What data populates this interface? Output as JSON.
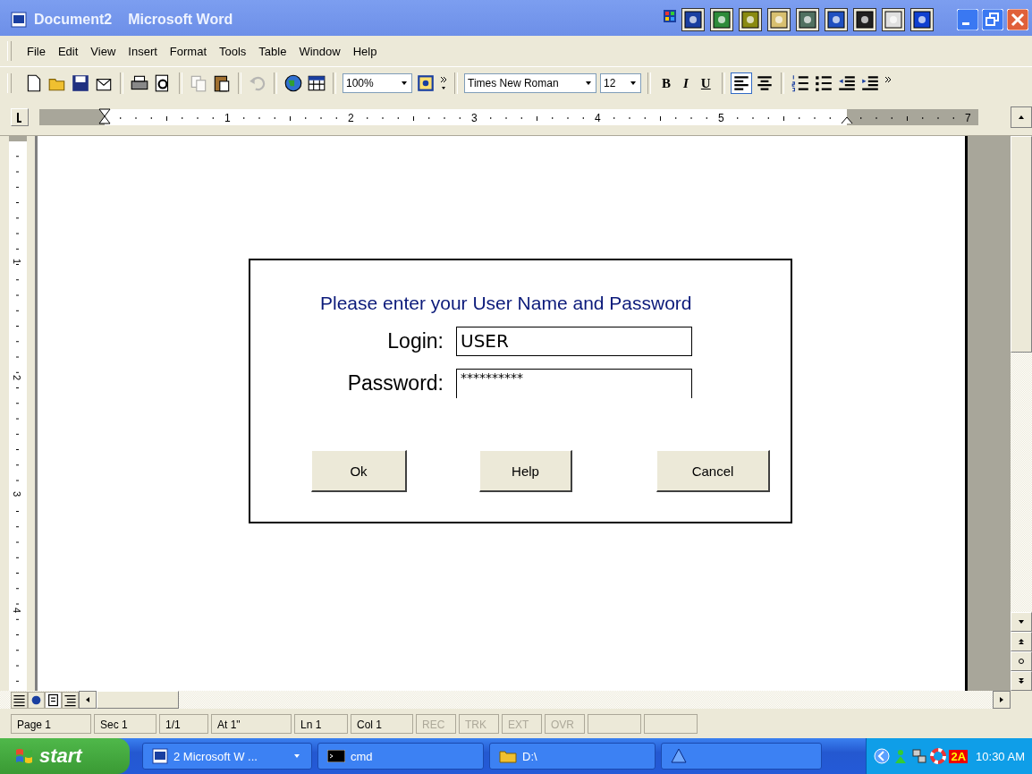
{
  "window": {
    "title": "Document2",
    "app": "Microsoft Word"
  },
  "menu": [
    "File",
    "Edit",
    "View",
    "Insert",
    "Format",
    "Tools",
    "Table",
    "Window",
    "Help"
  ],
  "toolbar": {
    "zoom": "100%",
    "font": "Times New Roman",
    "size": "12",
    "format_keys": [
      "B",
      "I",
      "U"
    ]
  },
  "ruler": {
    "h_numbers": [
      "1",
      "2",
      "3",
      "4",
      "5",
      "7"
    ],
    "v_numbers": [
      "1",
      "2",
      "3",
      "4"
    ]
  },
  "dialog": {
    "heading": "Please enter your User Name and Password",
    "fields": [
      {
        "label": "Login:",
        "value": "USER",
        "kind": "text"
      },
      {
        "label": "Password:",
        "value": "**********",
        "kind": "password"
      }
    ],
    "buttons": [
      "Ok",
      "Help",
      "Cancel"
    ]
  },
  "status_bar": [
    {
      "text": "Page 1",
      "disabled": false
    },
    {
      "text": "Sec 1",
      "disabled": false
    },
    {
      "text": "1/1",
      "disabled": false
    },
    {
      "text": "At 1\"",
      "disabled": false
    },
    {
      "text": "Ln 1",
      "disabled": false
    },
    {
      "text": "Col 1",
      "disabled": false
    },
    {
      "text": "REC",
      "disabled": true
    },
    {
      "text": "TRK",
      "disabled": true
    },
    {
      "text": "EXT",
      "disabled": true
    },
    {
      "text": "OVR",
      "disabled": true
    }
  ],
  "taskbar": {
    "start": "start",
    "tasks": [
      {
        "label": "2 Microsoft W ...",
        "kind": "word"
      },
      {
        "label": "cmd",
        "kind": "console"
      },
      {
        "label": "D:\\",
        "kind": "folder"
      },
      {
        "kind": "app"
      }
    ],
    "clock": "10:30 AM",
    "tray_badge": "2A"
  }
}
